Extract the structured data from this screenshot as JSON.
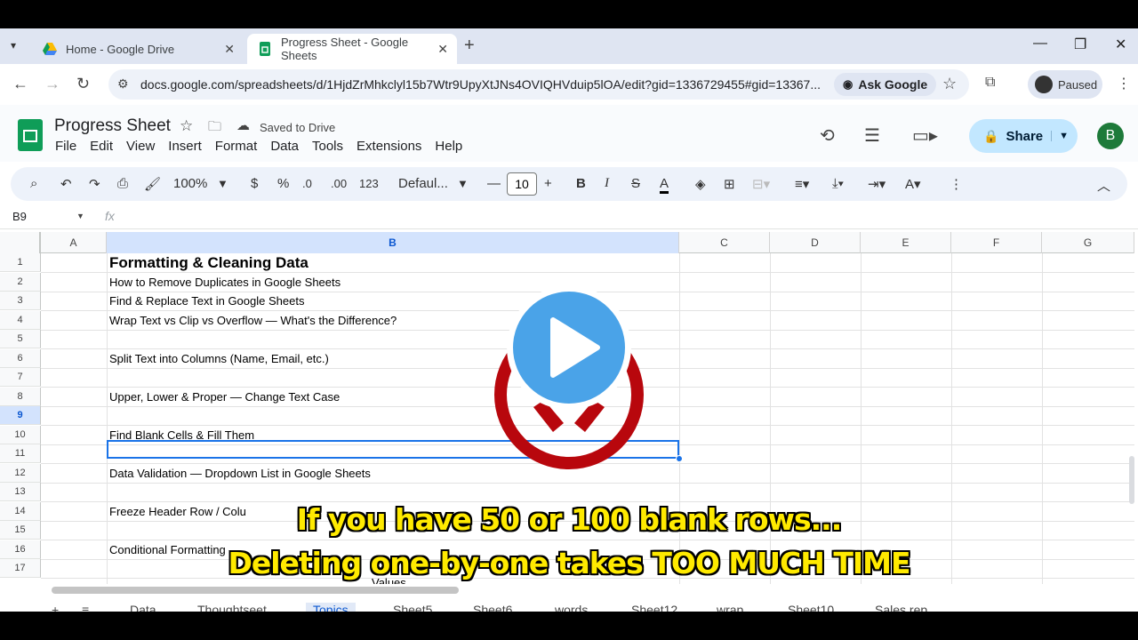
{
  "browser": {
    "tabs": [
      {
        "title": "Home - Google Drive",
        "active": false
      },
      {
        "title": "Progress Sheet - Google Sheets",
        "active": true
      }
    ],
    "url": "docs.google.com/spreadsheets/d/1HjdZrMhkclyl15b7Wtr9UpyXtJNs4OVIQHVduip5lOA/edit?gid=1336729455#gid=13367...",
    "ask_google": "Ask Google",
    "profile_status": "Paused"
  },
  "sheets": {
    "doc_title": "Progress Sheet",
    "saved_status": "Saved to Drive",
    "menu": [
      "File",
      "Edit",
      "View",
      "Insert",
      "Format",
      "Data",
      "Tools",
      "Extensions",
      "Help"
    ],
    "share_label": "Share",
    "user_initial": "B",
    "toolbar": {
      "zoom": "100%",
      "currency": "$",
      "percent": "%",
      "decrease_decimal": ".0",
      "increase_decimal": ".00",
      "number_format": "123",
      "font": "Defaul...",
      "font_size": "10",
      "bold": "B",
      "italic": "I",
      "text_color": "A"
    },
    "name_box": "B9",
    "fx_label": "fx",
    "columns": [
      "A",
      "B",
      "C",
      "D",
      "E",
      "F",
      "G"
    ],
    "selected_column": "B",
    "selected_row": "9",
    "rows": [
      {
        "num": "1",
        "b": "Formatting & Cleaning Data"
      },
      {
        "num": "2",
        "b": "How to Remove Duplicates in Google Sheets"
      },
      {
        "num": "3",
        "b": "Find & Replace Text in Google Sheets"
      },
      {
        "num": "4",
        "b": "Wrap Text vs Clip vs Overflow — What's the Difference?"
      },
      {
        "num": "5",
        "b": ""
      },
      {
        "num": "6",
        "b": "Split Text into Columns (Name, Email, etc.)"
      },
      {
        "num": "7",
        "b": ""
      },
      {
        "num": "8",
        "b": "Upper, Lower & Proper — Change Text Case"
      },
      {
        "num": "9",
        "b": ""
      },
      {
        "num": "10",
        "b": "Find Blank Cells & Fill Them"
      },
      {
        "num": "11",
        "b": ""
      },
      {
        "num": "12",
        "b": "Data Validation — Dropdown List in Google Sheets"
      },
      {
        "num": "13",
        "b": ""
      },
      {
        "num": "14",
        "b": "Freeze Header Row / Colu"
      },
      {
        "num": "15",
        "b": ""
      },
      {
        "num": "16",
        "b": "Conditional Formatting —"
      },
      {
        "num": "17",
        "b": ""
      }
    ],
    "row16_tail": "Values",
    "sheet_tabs": [
      "Data",
      "Thoughtseet",
      "Topics",
      "Sheet5",
      "Sheet6",
      "words",
      "Sheet12",
      "wrap",
      "Sheet10",
      "Sales rep"
    ],
    "active_sheet": "Topics"
  },
  "overlay": {
    "caption_line1": "If you have 50 or 100 blank rows...",
    "caption_line2": "Deleting one-by-one takes TOO MUCH TIME",
    "play_color": "#4aa3e8",
    "logo_color": "#b8070d"
  }
}
